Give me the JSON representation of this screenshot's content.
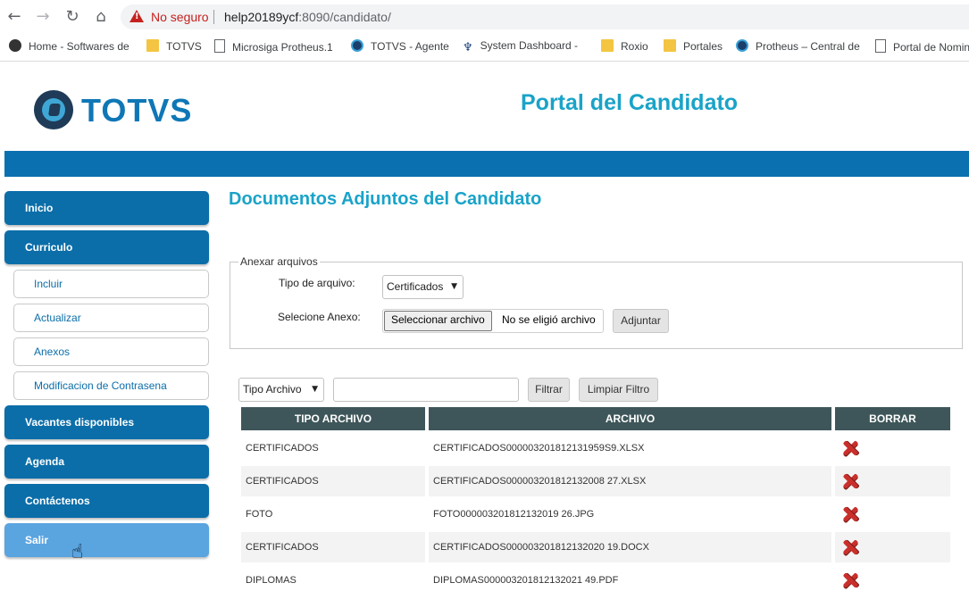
{
  "browser": {
    "not_secure": "No seguro",
    "url_host": "help20189ycf",
    "url_rest": ":8090/candidato/",
    "bookmarks": [
      {
        "label": "Home - Softwares de",
        "icon": "github-icon"
      },
      {
        "label": "TOTVS",
        "icon": "folder-icon"
      },
      {
        "label": "Microsiga Protheus.1",
        "icon": "page-icon"
      },
      {
        "label": "TOTVS - Agente",
        "icon": "globe-icon"
      },
      {
        "label": "System Dashboard -",
        "icon": "person-icon"
      },
      {
        "label": "Roxio",
        "icon": "folder-icon"
      },
      {
        "label": "Portales",
        "icon": "folder-icon"
      },
      {
        "label": "Protheus – Central de",
        "icon": "globe-icon"
      },
      {
        "label": "Portal de Nomin",
        "icon": "page-icon"
      }
    ]
  },
  "header": {
    "brand": "TOTVS",
    "portal_title": "Portal del Candidato"
  },
  "sidebar": {
    "inicio": "Inicio",
    "curriculo": "Curriculo",
    "sub": [
      "Incluir",
      "Actualizar",
      "Anexos",
      "Modificacion de Contrasena"
    ],
    "vacantes": "Vacantes disponibles",
    "agenda": "Agenda",
    "contactenos": "Contáctenos",
    "salir": "Salir"
  },
  "main": {
    "title": "Documentos Adjuntos del Candidato",
    "attach": {
      "legend": "Anexar arquivos",
      "type_label": "Tipo de arquivo:",
      "type_value": "Certificados",
      "file_label": "Selecione Anexo:",
      "file_button": "Seleccionar archivo",
      "file_status": "No se eligió archivo",
      "attach_button": "Adjuntar"
    },
    "filter": {
      "type_select": "Tipo Archivo",
      "filter_button": "Filtrar",
      "clear_button": "Limpiar Filtro"
    },
    "table": {
      "headers": [
        "TIPO ARCHIVO",
        "ARCHIVO",
        "BORRAR"
      ],
      "rows": [
        {
          "tipo": "CERTIFICADOS",
          "archivo": "CERTIFICADOS000003201812131959S9.XLSX"
        },
        {
          "tipo": "CERTIFICADOS",
          "archivo": "CERTIFICADOS000003201812132008 27.XLSX"
        },
        {
          "tipo": "FOTO",
          "archivo": "FOTO000003201812132019 26.JPG"
        },
        {
          "tipo": "CERTIFICADOS",
          "archivo": "CERTIFICADOS000003201812132020 19.DOCX"
        },
        {
          "tipo": "DIPLOMAS",
          "archivo": "DIPLOMAS000003201812132021 49.PDF"
        }
      ]
    }
  }
}
